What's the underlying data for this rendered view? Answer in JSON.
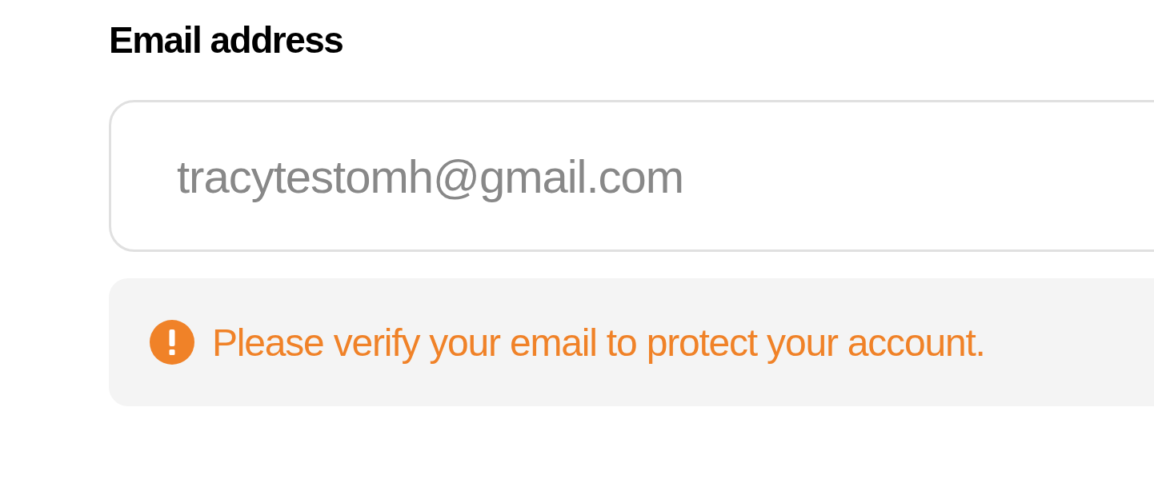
{
  "email_field": {
    "label": "Email address",
    "value": "tracytestomh@gmail.com"
  },
  "notice": {
    "kind": "warning",
    "text": "Please verify your email to protect your account."
  }
}
